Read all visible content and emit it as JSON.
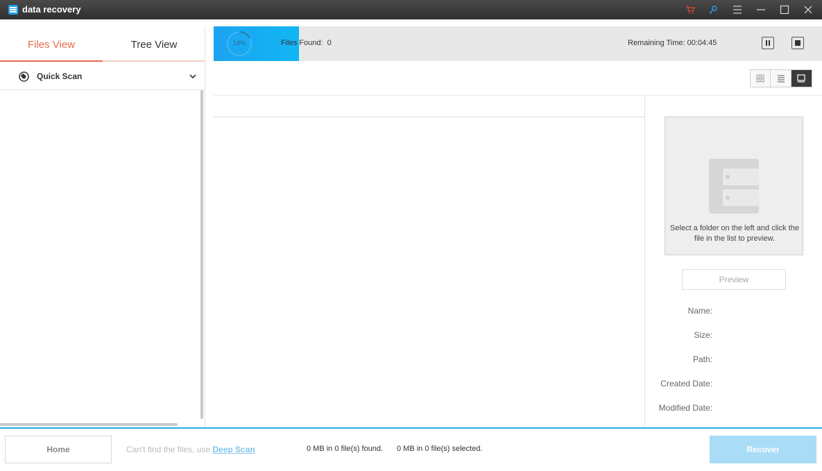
{
  "window": {
    "title": "data recovery",
    "icons": [
      "cart-icon",
      "key-icon",
      "menu-icon",
      "minimize-icon",
      "maximize-icon",
      "close-icon"
    ]
  },
  "left_panel": {
    "tabs": [
      {
        "label": "Files View",
        "active": true
      },
      {
        "label": "Tree View",
        "active": false
      }
    ],
    "scan_type": "Quick Scan"
  },
  "scan_status": {
    "progress_percent": 14,
    "progress_label": "14%",
    "files_found_label": "Files Found:",
    "files_found_value": "0",
    "remaining_label": "Remaining Time:",
    "remaining_value": "00:04:45"
  },
  "view_modes": [
    "grid-view",
    "list-view",
    "preview-view"
  ],
  "preview": {
    "hint": "Select a folder on the left and click the file in the list to preview.",
    "button_label": "Preview",
    "fields": {
      "name": "Name:",
      "size": "Size:",
      "path": "Path:",
      "created": "Created Date:",
      "modified": "Modified Date:"
    }
  },
  "bottom": {
    "home_label": "Home",
    "cant_find_text": "Can't find the files, use",
    "deep_scan_label": "Deep Scan",
    "found_status": "0 MB in 0 file(s) found.",
    "selected_status": "0 MB in 0 file(s) selected.",
    "recover_label": "Recover"
  },
  "colors": {
    "accent_orange": "#e8694a",
    "accent_blue": "#1ca3f0",
    "recover_disabled": "#a9dcf6"
  }
}
